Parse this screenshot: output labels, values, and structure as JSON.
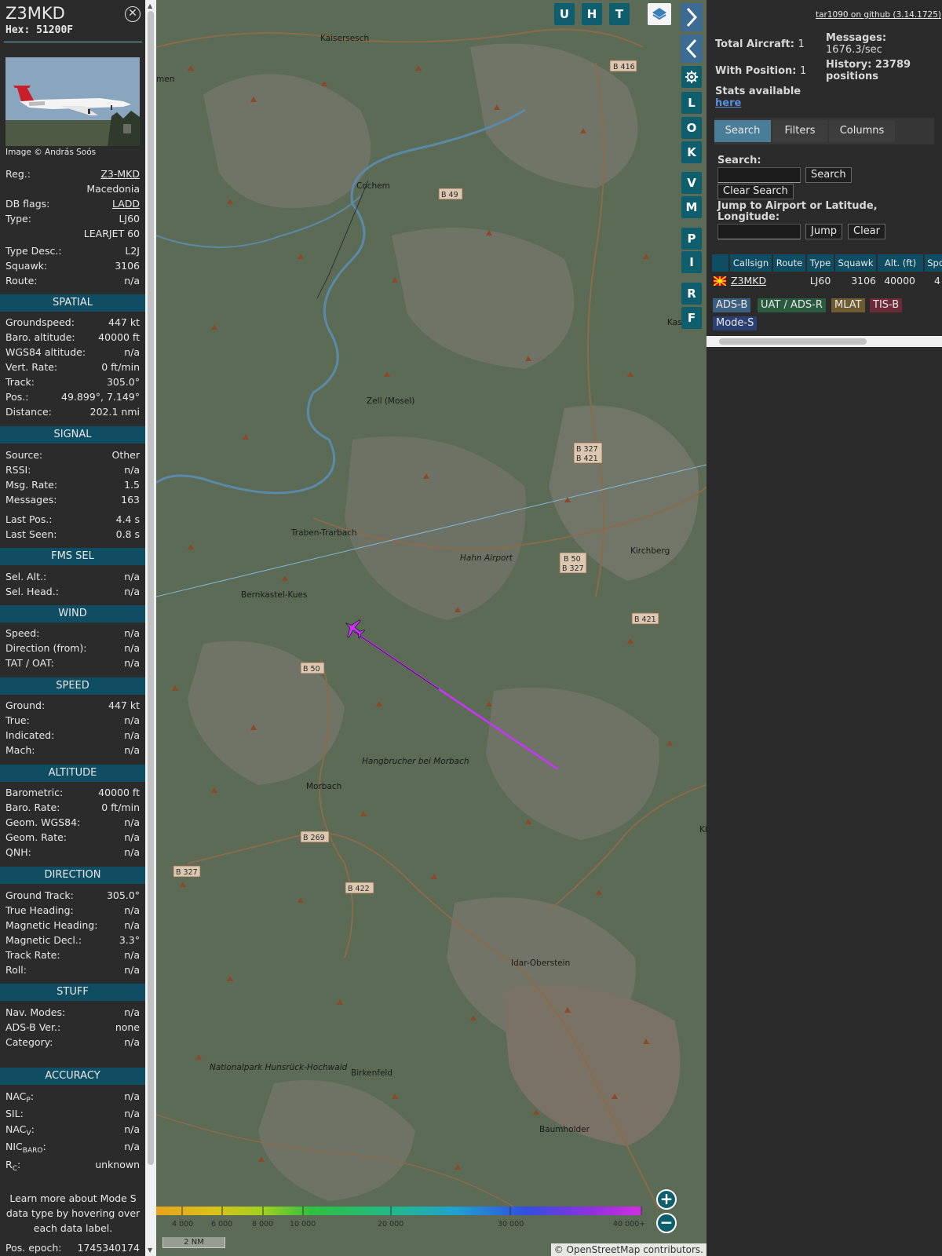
{
  "aircraft": {
    "callsign": "Z3MKD",
    "hex": "Hex: 51200F",
    "photo_credit": "Image © András Soós",
    "reg_label": "Reg.:",
    "reg": "Z3-MKD",
    "country": "Macedonia",
    "dbflags_label": "DB flags:",
    "dbflags": "LADD",
    "type_label": "Type:",
    "type": "LJ60",
    "type_name": "LEARJET 60",
    "typedesc_label": "Type Desc.:",
    "typedesc": "L2J",
    "squawk_label": "Squawk:",
    "squawk": "3106",
    "route_label": "Route:",
    "route": "n/a"
  },
  "sections": {
    "spatial": {
      "title": "SPATIAL",
      "rows": [
        {
          "k": "Groundspeed:",
          "v": "447 kt"
        },
        {
          "k": "Baro. altitude:",
          "v": "40000 ft"
        },
        {
          "k": "WGS84 altitude:",
          "v": "n/a"
        },
        {
          "k": "Vert. Rate:",
          "v": "0 ft/min"
        },
        {
          "k": "Track:",
          "v": "305.0°"
        },
        {
          "k": "Pos.:",
          "v": "49.899°, 7.149°"
        },
        {
          "k": "Distance:",
          "v": "202.1 nmi"
        }
      ]
    },
    "signal": {
      "title": "SIGNAL",
      "rows": [
        {
          "k": "Source:",
          "v": "Other"
        },
        {
          "k": "RSSI:",
          "v": "n/a"
        },
        {
          "k": "Msg. Rate:",
          "v": "1.5"
        },
        {
          "k": "Messages:",
          "v": "163"
        },
        {
          "k": "Last Pos.:",
          "v": "4.4 s"
        },
        {
          "k": "Last Seen:",
          "v": "0.8 s"
        }
      ]
    },
    "fms": {
      "title": "FMS SEL",
      "rows": [
        {
          "k": "Sel. Alt.:",
          "v": "n/a"
        },
        {
          "k": "Sel. Head.:",
          "v": "n/a"
        }
      ]
    },
    "wind": {
      "title": "WIND",
      "rows": [
        {
          "k": "Speed:",
          "v": "n/a"
        },
        {
          "k": "Direction (from):",
          "v": "n/a"
        },
        {
          "k": "TAT / OAT:",
          "v": "n/a"
        }
      ]
    },
    "speed": {
      "title": "SPEED",
      "rows": [
        {
          "k": "Ground:",
          "v": "447 kt"
        },
        {
          "k": "True:",
          "v": "n/a"
        },
        {
          "k": "Indicated:",
          "v": "n/a"
        },
        {
          "k": "Mach:",
          "v": "n/a"
        }
      ]
    },
    "altitude": {
      "title": "ALTITUDE",
      "rows": [
        {
          "k": "Barometric:",
          "v": "40000 ft"
        },
        {
          "k": "Baro. Rate:",
          "v": "0 ft/min"
        },
        {
          "k": "Geom. WGS84:",
          "v": "n/a"
        },
        {
          "k": "Geom. Rate:",
          "v": "n/a"
        },
        {
          "k": "QNH:",
          "v": "n/a"
        }
      ]
    },
    "direction": {
      "title": "DIRECTION",
      "rows": [
        {
          "k": "Ground Track:",
          "v": "305.0°"
        },
        {
          "k": "True Heading:",
          "v": "n/a"
        },
        {
          "k": "Magnetic Heading:",
          "v": "n/a"
        },
        {
          "k": "Magnetic Decl.:",
          "v": "3.3°"
        },
        {
          "k": "Track Rate:",
          "v": "n/a"
        },
        {
          "k": "Roll:",
          "v": "n/a"
        }
      ]
    },
    "stuff": {
      "title": "STUFF",
      "rows": [
        {
          "k": "Nav. Modes:",
          "v": "n/a"
        },
        {
          "k": "ADS-B Ver.:",
          "v": "none"
        },
        {
          "k": "Category:",
          "v": "n/a"
        }
      ]
    },
    "accuracy": {
      "title": "ACCURACY",
      "nacp_main": "NAC",
      "nacp_sub": "P",
      "nacp_suffix": ":",
      "nacp_v": "n/a",
      "sil_k": "SIL:",
      "sil_v": "n/a",
      "nacv_main": "NAC",
      "nacv_sub": "V",
      "nacv_suffix": ":",
      "nacv_v": "n/a",
      "nic_main": "NIC",
      "nic_sub": "BARO",
      "nic_suffix": ":",
      "nic_v": "n/a",
      "rc_main": "R",
      "rc_sub": "C",
      "rc_suffix": ":",
      "rc_v": "unknown"
    },
    "note": "Learn more about Mode S data type by hovering over each data label.",
    "epoch_k": "Pos. epoch:",
    "epoch_v": "1745340174"
  },
  "map": {
    "places": [
      "Kaisersesch",
      "men",
      "Cochem",
      "Zell (Mosel)",
      "Traben-Trarbach",
      "Hahn Airport",
      "Kirchberg",
      "Bernkastel-Kues",
      "Hangbrucher bei Morbach",
      "Morbach",
      "Idar-Oberstein",
      "Birkenfeld",
      "Baumholder",
      "Nationalpark Hunsrück-Hochwald",
      "Kas",
      "Ki"
    ],
    "roads": [
      "B 416",
      "B 49",
      "B 327",
      "B 421",
      "B 50",
      "B 327",
      "B 421",
      "B 50",
      "B 269",
      "B 327",
      "B 422"
    ],
    "scale": "2 NM",
    "attribution": "© OpenStreetMap contributors.",
    "altitude_ticks": [
      "4 000",
      "6 000",
      "8 000",
      "10 000",
      "20 000",
      "30 000",
      "40 000+"
    ],
    "buttons": {
      "u": "U",
      "h": "H",
      "t": "T",
      "l": "L",
      "o": "O",
      "k": "K",
      "v": "V",
      "m": "M",
      "p": "P",
      "i": "I",
      "r": "R",
      "f": "F"
    },
    "zoom_in": "+",
    "zoom_out": "−",
    "track_color": "#cc33ff",
    "aircraft_color": "#cc33ff"
  },
  "right": {
    "github": "tar1090 on github (3.14.1725)",
    "total_label": "Total Aircraft:",
    "total": "1",
    "messages_label": "Messages:",
    "messages": "1676.3/sec",
    "withpos_label": "With Position:",
    "withpos": "1",
    "history_label": "History: 23789 positions",
    "stats_label": "Stats available",
    "stats_link": "here",
    "tabs": [
      "Search",
      "Filters",
      "Columns"
    ],
    "search_label": "Search:",
    "search_btn": "Search",
    "clear_search": "Clear Search",
    "jump_label": "Jump to Airport or Latitude, Longitude:",
    "jump_btn": "Jump",
    "clear_btn": "Clear",
    "columns": [
      "Callsign",
      "Route",
      "Type",
      "Squawk",
      "Alt. (ft)",
      "Spd."
    ],
    "row": {
      "callsign": "Z3MKD",
      "route": "",
      "type": "LJ60",
      "squawk": "3106",
      "alt": "40000",
      "spd": "4"
    },
    "badges": [
      "ADS-B",
      "UAT / ADS-R",
      "MLAT",
      "TIS-B",
      "Mode-S"
    ]
  }
}
